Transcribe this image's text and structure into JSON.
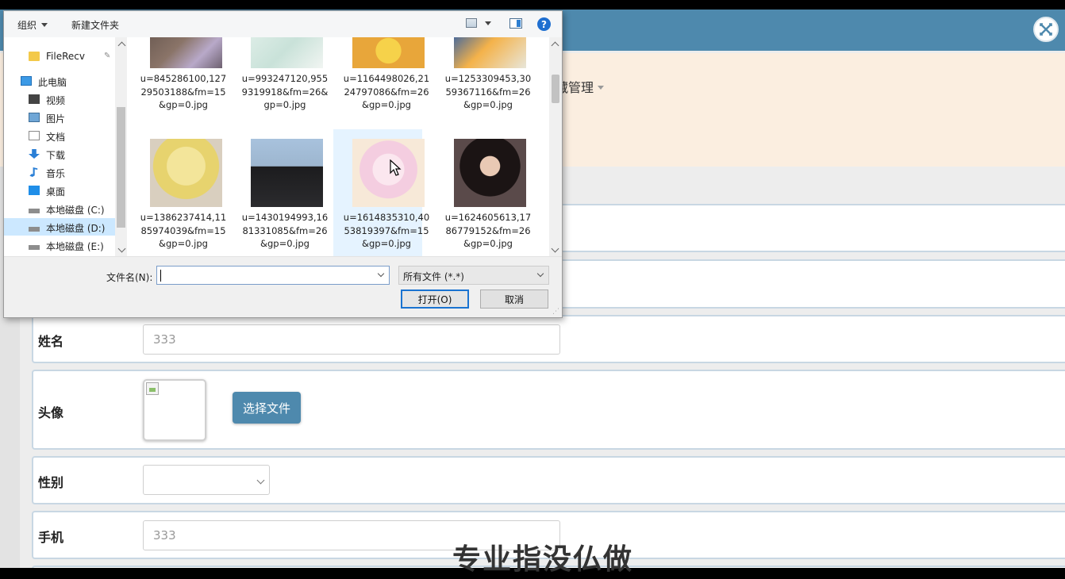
{
  "app": {
    "colors": {
      "header": "#4e89ad",
      "nav_bar": "#fbeee0",
      "primary_button": "#4e89ad"
    },
    "nav": {
      "item_label": "藏管理",
      "item_icon": "caret-down-icon"
    },
    "close_icon": "close-icon",
    "form": {
      "name": {
        "label": "姓名",
        "placeholder": "333"
      },
      "avatar": {
        "label": "头像",
        "choose_file_label": "选择文件"
      },
      "gender": {
        "label": "性别",
        "selected": ""
      },
      "phone": {
        "label": "手机",
        "placeholder": "333"
      }
    },
    "bottom_text": "专业指没仏做"
  },
  "dialog": {
    "toolbar": {
      "organize_label": "组织",
      "new_folder_label": "新建文件夹",
      "help_symbol": "?"
    },
    "nav_items": [
      {
        "label": "FileRecv",
        "icon": "folder-icon"
      },
      {
        "label": "此电脑",
        "icon": "computer-icon"
      },
      {
        "label": "视频",
        "icon": "video-icon"
      },
      {
        "label": "图片",
        "icon": "picture-icon"
      },
      {
        "label": "文档",
        "icon": "document-icon"
      },
      {
        "label": "下载",
        "icon": "download-icon"
      },
      {
        "label": "音乐",
        "icon": "music-icon"
      },
      {
        "label": "桌面",
        "icon": "desktop-icon"
      },
      {
        "label": "本地磁盘 (C:)",
        "icon": "drive-icon"
      },
      {
        "label": "本地磁盘 (D:)",
        "icon": "drive-icon"
      },
      {
        "label": "本地磁盘 (E:)",
        "icon": "drive-icon"
      }
    ],
    "selected_nav": "本地磁盘 (D:)",
    "files_top": [
      {
        "name": "u=845286100,12729503188&fm=15&gp=0.jpg"
      },
      {
        "name": "u=993247120,9559319918&fm=26&gp=0.jpg"
      },
      {
        "name": "u=1164498026,2124797086&fm=26&gp=0.jpg"
      },
      {
        "name": "u=1253309453,3059367116&fm=26&gp=0.jpg"
      }
    ],
    "files_bottom": [
      {
        "name": "u=1386237414,1185974039&fm=15&gp=0.jpg"
      },
      {
        "name": "u=1430194993,1681331085&fm=26&gp=0.jpg"
      },
      {
        "name": "u=1614835310,4053819397&fm=15&gp=0.jpg"
      },
      {
        "name": "u=1624605613,1786779152&fm=26&gp=0.jpg"
      }
    ],
    "selected_file": "u=1614835310,4053819397&fm=15&gp=0.jpg",
    "filename_label": "文件名(N):",
    "filename_value": "",
    "filetype_selected": "所有文件 (*.*)",
    "open_button": "打开(O)",
    "cancel_button": "取消"
  }
}
